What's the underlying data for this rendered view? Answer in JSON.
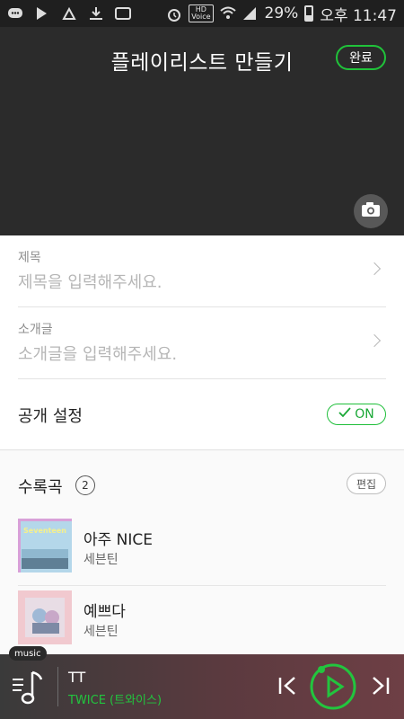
{
  "status_bar": {
    "battery": "29%",
    "time": "오후 11:47",
    "hd_label": "HD",
    "hd_sub": "Voice"
  },
  "header": {
    "title": "플레이리스트 만들기",
    "done_label": "완료"
  },
  "form": {
    "title_label": "제목",
    "title_placeholder": "제목을 입력해주세요.",
    "intro_label": "소개글",
    "intro_placeholder": "소개글을 입력해주세요.",
    "public_label": "공개 설정",
    "public_toggle": "ON"
  },
  "tracks": {
    "header": "수록곡",
    "count": "2",
    "edit_label": "편집",
    "items": [
      {
        "title": "아주 NICE",
        "artist": "세븐틴"
      },
      {
        "title": "예쁘다",
        "artist": "세븐틴"
      }
    ]
  },
  "player": {
    "tab_label": "music",
    "title": "TT",
    "artist": "TWICE (트와이스)"
  },
  "colors": {
    "accent": "#20c33a",
    "header_bg": "#2b2b2b"
  }
}
